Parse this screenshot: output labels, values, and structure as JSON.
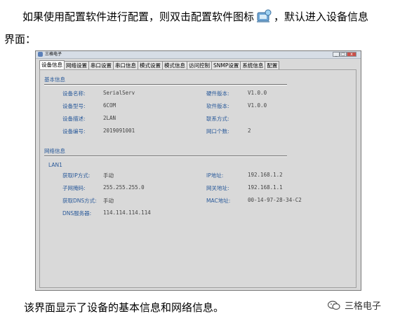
{
  "intro": {
    "before_icon": "如果使用配置软件进行配置，则双击配置软件图标",
    "after_icon": "，默认进入设备信息",
    "line2": "界面："
  },
  "window": {
    "title": "三格电子",
    "controls": [
      "_",
      "□",
      "x"
    ]
  },
  "tabs": [
    "设备信息",
    "网络设置",
    "串口设置",
    "串口信息",
    "模式设置",
    "模式信息",
    "访问控制",
    "SNMP设置",
    "系统信息",
    "配置"
  ],
  "basic": {
    "section_title": "基本信息",
    "left": [
      {
        "label": "设备名称:",
        "value": "SerialServ"
      },
      {
        "label": "设备型号:",
        "value": "6COM"
      },
      {
        "label": "设备描述:",
        "value": "2LAN"
      },
      {
        "label": "设备编号:",
        "value": "2019091001"
      }
    ],
    "right": [
      {
        "label": "硬件版本:",
        "value": "V1.0.0"
      },
      {
        "label": "软件版本:",
        "value": "V1.0.0"
      },
      {
        "label": "联系方式:",
        "value": ""
      },
      {
        "label": "网口个数:",
        "value": "2"
      }
    ]
  },
  "network": {
    "section_title": "网络信息",
    "lan_label": "LAN1",
    "left": [
      {
        "label": "获取IP方式:",
        "value": "手动"
      },
      {
        "label": "子网掩码:",
        "value": "255.255.255.0"
      },
      {
        "label": "获取DNS方式:",
        "value": "手动"
      },
      {
        "label": "DNS服务器:",
        "value": "114.114.114.114"
      }
    ],
    "right": [
      {
        "label": "IP地址:",
        "value": "192.168.1.2"
      },
      {
        "label": "网关地址:",
        "value": "192.168.1.1"
      },
      {
        "label": "MAC地址:",
        "value": "00-14-97-28-34-C2"
      }
    ]
  },
  "outro": "该界面显示了设备的基本信息和网络信息。",
  "watermark": "三格电子"
}
